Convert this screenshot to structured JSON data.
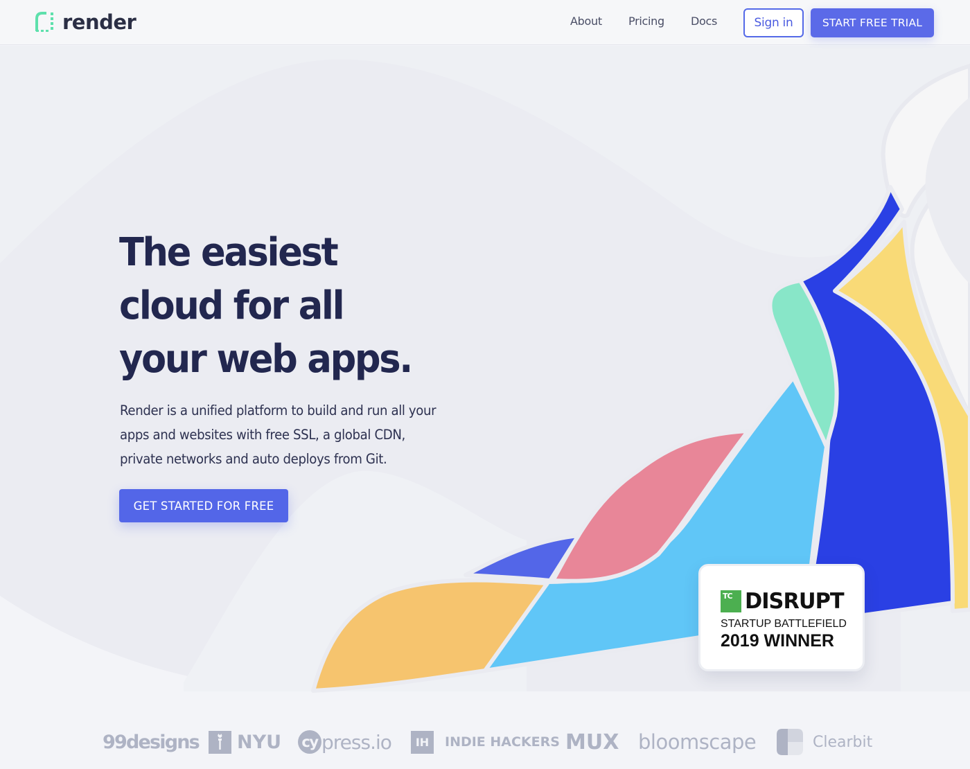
{
  "brand": {
    "name": "render",
    "icon": "render-logo-icon",
    "accent_color": "#5ee0ac"
  },
  "nav": {
    "links": [
      {
        "label": "About"
      },
      {
        "label": "Pricing"
      },
      {
        "label": "Docs"
      }
    ],
    "signin_label": "Sign in",
    "trial_label": "START FREE TRIAL"
  },
  "hero": {
    "title_lines": [
      "The easiest",
      "cloud for all",
      "your web apps."
    ],
    "description_lines": [
      "Render is a unified platform to build and run all your",
      "apps and websites with free SSL, a global CDN,",
      "private networks and auto deploys from Git."
    ],
    "cta_label": "GET STARTED FOR FREE"
  },
  "badge": {
    "tc_mark": "TC",
    "title": "DISRUPT",
    "subtitle": "STARTUP BATTLEFIELD",
    "year_line": "2019 WINNER",
    "tc_color": "#4caf50"
  },
  "customer_logos": [
    {
      "name": "99designs"
    },
    {
      "name": "NYU"
    },
    {
      "name": "cypress.io",
      "mark": "cy",
      "text": "press.io"
    },
    {
      "name": "INDIE HACKERS",
      "mark": "IH"
    },
    {
      "name": "MUX"
    },
    {
      "name": "bloomscape"
    },
    {
      "name": "Clearbit"
    }
  ],
  "colors": {
    "primary": "#5b6ae8",
    "heading": "#22274f",
    "art_blue": "#2a40e4",
    "art_sky": "#60c6f7",
    "art_mint": "#88e6c8",
    "art_yellow": "#f9da77",
    "art_orange": "#f6c46e",
    "art_pink": "#e88698",
    "art_indigo": "#5366e8"
  }
}
